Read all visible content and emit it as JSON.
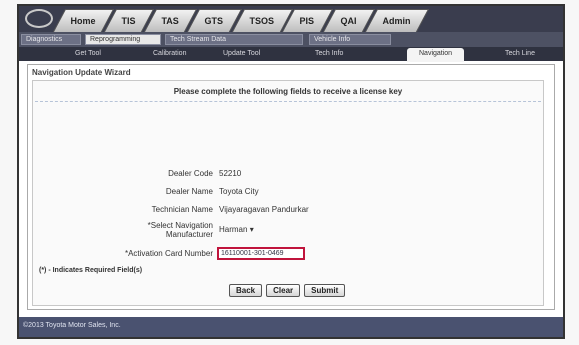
{
  "tabs": [
    "Home",
    "TIS",
    "TAS",
    "GTS",
    "TSOS",
    "PIS",
    "QAI",
    "Admin"
  ],
  "subnav": [
    "Diagnostics",
    "Reprogramming",
    "Tech Stream Data",
    "Vehicle Info"
  ],
  "nav3": [
    "Get Tool",
    "Calibration",
    "Update Tool",
    "Tech Info",
    "Navigation",
    "Tech Line"
  ],
  "panel": {
    "title": "Navigation Update Wizard",
    "instructions": "Please complete the following fields to receive a license key"
  },
  "fields": {
    "dealer_code_label": "Dealer Code",
    "dealer_code_value": "52210",
    "dealer_name_label": "Dealer Name",
    "dealer_name_value": "Toyota City",
    "technician_name_label": "Technician Name",
    "technician_name_value": "Vijayaragavan Pandurkar",
    "manufacturer_label_1": "*Select Navigation",
    "manufacturer_label_2": "Manufacturer",
    "manufacturer_value": "Harman",
    "activation_label": "*Activation Card Number",
    "activation_value": "16110001-301-0469"
  },
  "required_note": "(*) - Indicates Required Field(s)",
  "buttons": {
    "back": "Back",
    "clear": "Clear",
    "submit": "Submit"
  },
  "footer": "©2013 Toyota Motor Sales, Inc."
}
